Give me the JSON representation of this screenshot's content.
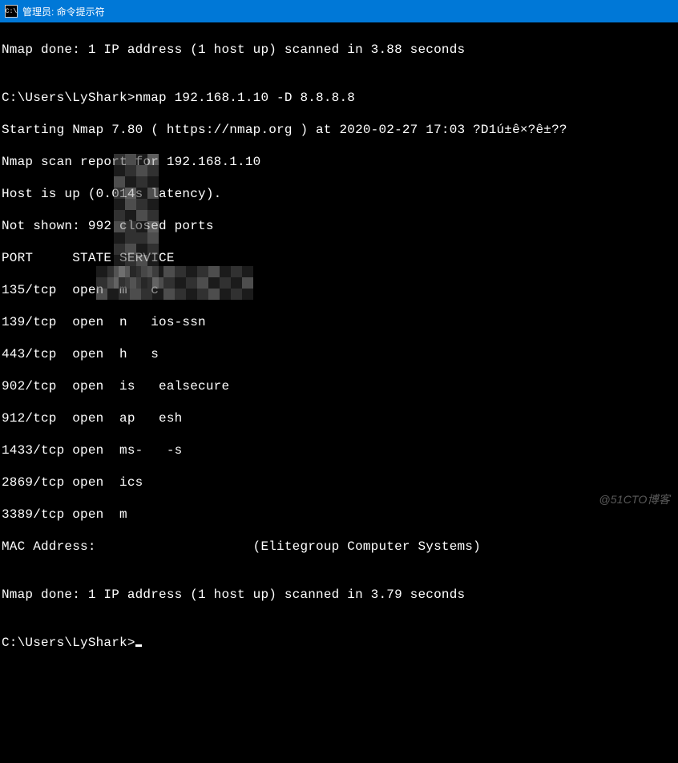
{
  "title": "管理员: 命令提示符",
  "terminal": {
    "line1": "Nmap done: 1 IP address (1 host up) scanned in 3.88 seconds",
    "blank1": "",
    "prompt1": "C:\\Users\\LyShark>nmap 192.168.1.10 -D 8.8.8.8",
    "starting": "Starting Nmap 7.80 ( https://nmap.org ) at 2020-02-27 17:03 ?D1ú±ê×?ê±??",
    "report": "Nmap scan report for 192.168.1.10",
    "hostup": "Host is up (0.014s latency).",
    "notshown": "Not shown: 992 closed ports",
    "header": "PORT     STATE SERVICE",
    "p135": "135/tcp  open  m   c",
    "p139": "139/tcp  open  n   ios-ssn",
    "p443": "443/tcp  open  h   s",
    "p902": "902/tcp  open  is   ealsecure",
    "p912": "912/tcp  open  ap   esh",
    "p1433": "1433/tcp open  ms-   -s",
    "p2869": "2869/tcp open  ics   ",
    "p3389": "3389/tcp open  m                 ",
    "mac": "MAC Address:                    (Elitegroup Computer Systems)",
    "blank2": "",
    "done2": "Nmap done: 1 IP address (1 host up) scanned in 3.79 seconds",
    "blank3": "",
    "prompt2": "C:\\Users\\LyShark>"
  },
  "watermark": "@51CTO博客"
}
